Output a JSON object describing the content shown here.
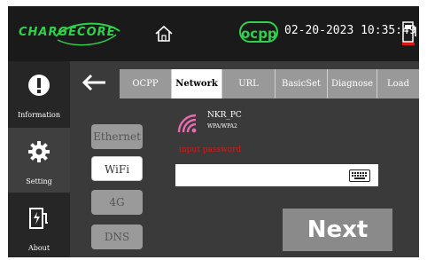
{
  "header": {
    "logo_text": "CHARGECORE",
    "ocpp_badge": "ocpp",
    "datetime": "02-20-2023 10:35:49"
  },
  "sidebar": {
    "items": [
      {
        "label": "Information",
        "icon": "info-icon"
      },
      {
        "label": "Setting",
        "icon": "gear-icon",
        "active": true
      },
      {
        "label": "About",
        "icon": "charger-about-icon"
      }
    ]
  },
  "tabs": [
    {
      "label": "OCPP"
    },
    {
      "label": "Network",
      "active": true
    },
    {
      "label": "URL"
    },
    {
      "label": "BasicSet"
    },
    {
      "label": "Diagnose"
    },
    {
      "label": "Load"
    }
  ],
  "network_types": [
    {
      "label": "Ethernet"
    },
    {
      "label": "WiFi",
      "active": true
    },
    {
      "label": "4G"
    },
    {
      "label": "DNS"
    }
  ],
  "wifi": {
    "ssid": "NKR_PC",
    "security": "WPA/WPA2",
    "password_prompt": "input password",
    "password_value": ""
  },
  "next_label": "Next",
  "colors": {
    "accent_green": "#2fd14a",
    "wifi_icon": "#e86bb0",
    "prompt_red": "#e01515"
  }
}
